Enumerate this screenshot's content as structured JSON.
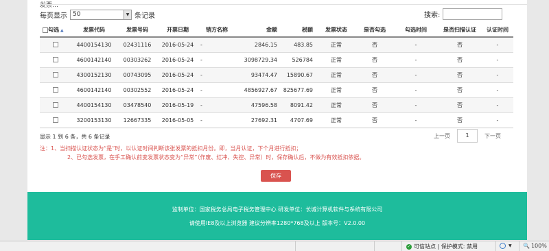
{
  "header": {
    "title_partial": "发票…"
  },
  "length_menu": {
    "prefix": "每页显示",
    "selected": "50",
    "suffix": "条记录"
  },
  "search": {
    "label": "搜索:",
    "value": ""
  },
  "table": {
    "columns": [
      "勾选",
      "发票代码",
      "发票号码",
      "开票日期",
      "销方名称",
      "金额",
      "税额",
      "发票状态",
      "是否勾选",
      "勾选时间",
      "是否扫描认证",
      "认证时间"
    ],
    "rows": [
      [
        "",
        "4400154130",
        "02431116",
        "2016-05-24",
        "-",
        "2846.15",
        "483.85",
        "正常",
        "否",
        "-",
        "否",
        "-"
      ],
      [
        "",
        "4600142140",
        "00303262",
        "2016-05-24",
        "-",
        "3098729.34",
        "526784",
        "正常",
        "否",
        "-",
        "否",
        "-"
      ],
      [
        "",
        "4300152130",
        "00743095",
        "2016-05-24",
        "-",
        "93474.47",
        "15890.67",
        "正常",
        "否",
        "-",
        "否",
        "-"
      ],
      [
        "",
        "4600142140",
        "00302552",
        "2016-05-24",
        "-",
        "4856927.67",
        "825677.69",
        "正常",
        "否",
        "-",
        "否",
        "-"
      ],
      [
        "",
        "4400154130",
        "03478540",
        "2016-05-19",
        "-",
        "47596.58",
        "8091.42",
        "正常",
        "否",
        "-",
        "否",
        "-"
      ],
      [
        "",
        "3200153130",
        "12667335",
        "2016-05-05",
        "-",
        "27692.31",
        "4707.69",
        "正常",
        "否",
        "-",
        "否",
        "-"
      ]
    ]
  },
  "info": "显示 1 到 6 条，共 6 条记录",
  "pager": {
    "prev": "上一页",
    "current": "1",
    "next": "下一页"
  },
  "notes": [
    "注：1、当扫描认证状态为“是”时，以认证时间判断该张发票的抵扣月份。即，当月认证，下个月进行抵扣；",
    "2、已勾选发票，在手工确认前变发票状态变为“异常”（作废、红冲、失控、异常）时，保存确认后，不做为有效抵扣依据。"
  ],
  "save_button": "保存",
  "footer": {
    "line1": "监制单位：国家税务总局电子税务管理中心   研发单位：长城计算机软件与系统有限公司",
    "line2": "请使用IE8及以上浏览器   建议分辨率1280*768及以上   版本号：V2.0.00"
  },
  "statusbar": {
    "trusted": "可信站点 | 保护模式: 禁用",
    "zoom": "100%"
  }
}
